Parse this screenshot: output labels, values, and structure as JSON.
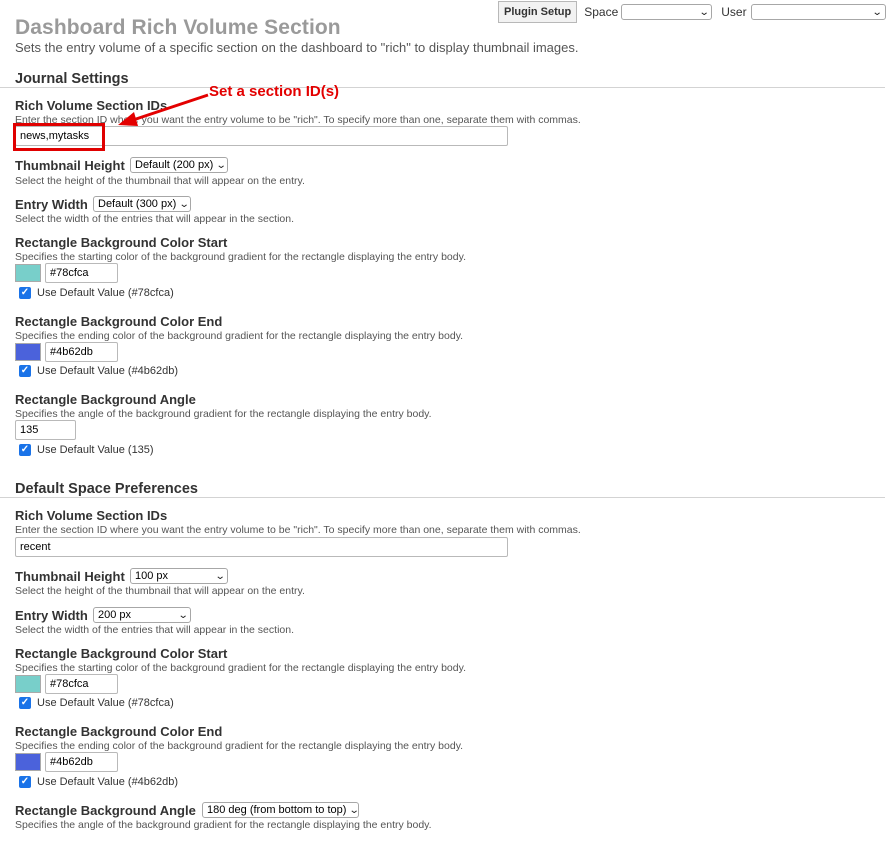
{
  "page": {
    "title": "Dashboard Rich Volume Section",
    "subtitle": "Sets the entry volume of a specific section on the dashboard to \"rich\" to display thumbnail images."
  },
  "topbar": {
    "plugin_setup": "Plugin Setup",
    "space_label": "Space",
    "space_value": "",
    "user_label": "User",
    "user_value": ""
  },
  "annotation": {
    "text": "Set a section ID(s)",
    "color": "#e30000"
  },
  "journal": {
    "heading": "Journal Settings",
    "rich_ids": {
      "label": "Rich Volume Section IDs",
      "help": "Enter the section ID where you want the entry volume to be \"rich\". To specify more than one, separate them with commas.",
      "value": "news,mytasks"
    },
    "thumb_height": {
      "label": "Thumbnail Height",
      "value": "Default (200 px)",
      "help": "Select the height of the thumbnail that will appear on the entry."
    },
    "entry_width": {
      "label": "Entry Width",
      "value": "Default (300 px)",
      "help": "Select the width of the entries that will appear in the section."
    },
    "color_start": {
      "label": "Rectangle Background Color Start",
      "help": "Specifies the starting color of the background gradient for the rectangle displaying the entry body.",
      "value": "#78cfca",
      "swatch": "#78cfca",
      "default_label": "Use Default Value (#78cfca)"
    },
    "color_end": {
      "label": "Rectangle Background Color End",
      "help": "Specifies the ending color of the background gradient for the rectangle displaying the entry body.",
      "value": "#4b62db",
      "swatch": "#4b62db",
      "default_label": "Use Default Value (#4b62db)"
    },
    "angle": {
      "label": "Rectangle Background Angle",
      "help": "Specifies the angle of the background gradient for the rectangle displaying the entry body.",
      "value": "135",
      "default_label": "Use Default Value (135)"
    }
  },
  "space": {
    "heading": "Default Space Preferences",
    "rich_ids": {
      "label": "Rich Volume Section IDs",
      "help": "Enter the section ID where you want the entry volume to be \"rich\". To specify more than one, separate them with commas.",
      "value": "recent"
    },
    "thumb_height": {
      "label": "Thumbnail Height",
      "value": "100 px",
      "help": "Select the height of the thumbnail that will appear on the entry."
    },
    "entry_width": {
      "label": "Entry Width",
      "value": "200 px",
      "help": "Select the width of the entries that will appear in the section."
    },
    "color_start": {
      "label": "Rectangle Background Color Start",
      "help": "Specifies the starting color of the background gradient for the rectangle displaying the entry body.",
      "value": "#78cfca",
      "swatch": "#78cfca",
      "default_label": "Use Default Value (#78cfca)"
    },
    "color_end": {
      "label": "Rectangle Background Color End",
      "help": "Specifies the ending color of the background gradient for the rectangle displaying the entry body.",
      "value": "#4b62db",
      "swatch": "#4b62db",
      "default_label": "Use Default Value (#4b62db)"
    },
    "angle": {
      "label": "Rectangle Background Angle",
      "value": "180 deg (from bottom to top)",
      "help": "Specifies the angle of the background gradient for the rectangle displaying the entry body."
    }
  }
}
